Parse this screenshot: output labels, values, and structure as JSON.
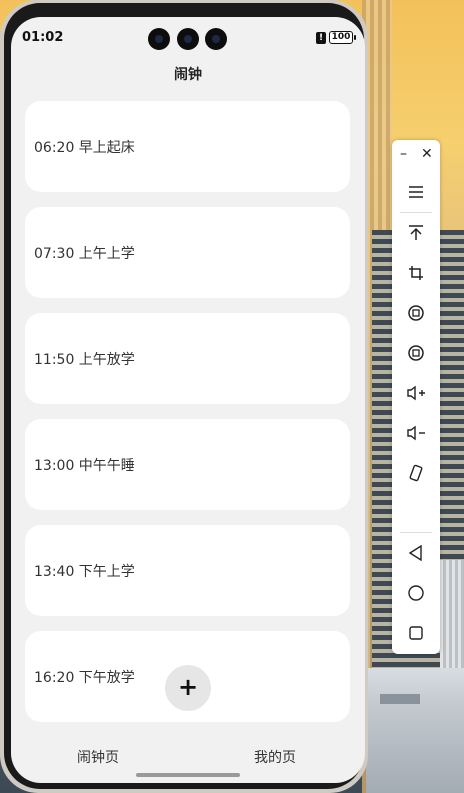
{
  "status_bar": {
    "time": "01:02",
    "battery": "100"
  },
  "header": {
    "title": "闹钟"
  },
  "alarms": [
    {
      "label": "06:20 早上起床"
    },
    {
      "label": "07:30 上午上学"
    },
    {
      "label": "11:50 上午放学"
    },
    {
      "label": "13:00 中午午睡"
    },
    {
      "label": "13:40 下午上学"
    },
    {
      "label": "16:20 下午放学"
    }
  ],
  "add_button": {
    "label": "+"
  },
  "tabs": [
    {
      "label": "闹钟页"
    },
    {
      "label": "我的页"
    }
  ],
  "side_toolbar": {
    "items": [
      "minimize-icon",
      "close-icon",
      "menu-icon",
      "pin-top-icon",
      "crop-icon",
      "rotate-left-icon",
      "rotate-right-icon",
      "volume-up-icon",
      "volume-down-icon",
      "shake-icon",
      "back-icon",
      "home-icon",
      "recents-icon"
    ]
  }
}
